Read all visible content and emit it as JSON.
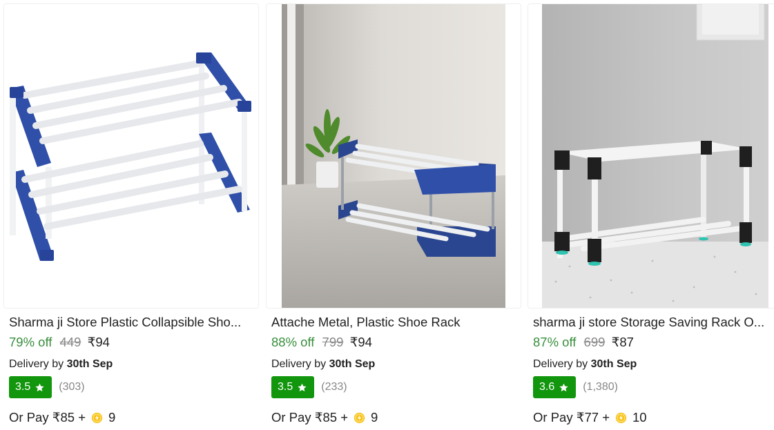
{
  "products": [
    {
      "title": "Sharma ji Store Plastic Collapsible Sho...",
      "discount": "79% off",
      "mrp": "449",
      "price": "₹94",
      "delivery_prefix": "Delivery by",
      "delivery_date": "30th Sep",
      "rating": "3.5",
      "rating_count": "(303)",
      "pay_prefix": "Or Pay ₹85 +",
      "coins": "9"
    },
    {
      "title": "Attache Metal, Plastic Shoe Rack",
      "discount": "88% off",
      "mrp": "799",
      "price": "₹94",
      "delivery_prefix": "Delivery by",
      "delivery_date": "30th Sep",
      "rating": "3.5",
      "rating_count": "(233)",
      "pay_prefix": "Or Pay ₹85 +",
      "coins": "9"
    },
    {
      "title": "sharma ji store Storage Saving Rack O...",
      "discount": "87% off",
      "mrp": "699",
      "price": "₹87",
      "delivery_prefix": "Delivery by",
      "delivery_date": "30th Sep",
      "rating": "3.6",
      "rating_count": "(1,380)",
      "pay_prefix": "Or Pay ₹77 +",
      "coins": "10"
    }
  ],
  "colors": {
    "discount_green": "#388e3c",
    "rating_badge_green": "#12960d",
    "muted_gray": "#878787",
    "coin_yellow": "#f7c21a"
  },
  "icons": {
    "rating": "star-icon",
    "coin": "supercoin-icon"
  }
}
